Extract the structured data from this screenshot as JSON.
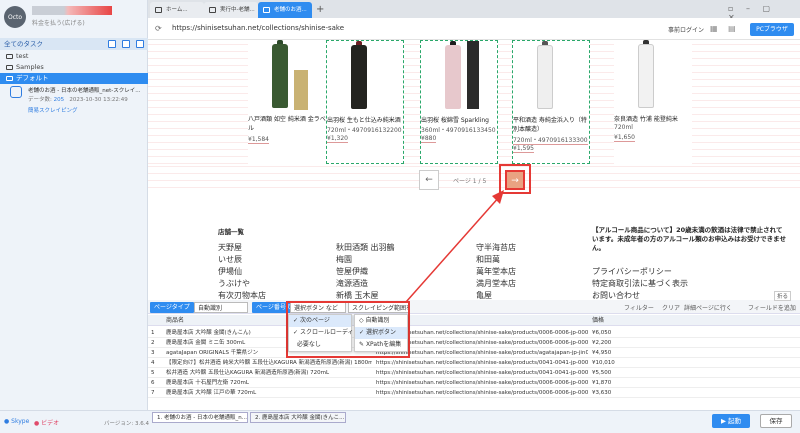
{
  "sidebar": {
    "logo_text": "Octo",
    "account_sub": "料金を払う(広げる)",
    "tasks_title": "全てのタスク",
    "tree": [
      {
        "label": "test"
      },
      {
        "label": "Samples"
      },
      {
        "label": "デフォルト"
      }
    ],
    "task": {
      "title": "老舗のお酒 - 日本の老舗通販_net-スクレイ...",
      "count_label": "データ数:",
      "count": "205",
      "date": "2023-10-30 13:22:49",
      "action": "簡易スクレイピング"
    },
    "skype": "Skype",
    "bilibili": "ビデオ",
    "version": "バージョン: 3.6.4"
  },
  "browser": {
    "tabs": [
      {
        "label": "ホーム..."
      },
      {
        "label": "実行中-老舗..."
      },
      {
        "label": "老舗のお酒..."
      }
    ],
    "new_tab": "+",
    "url": "https://shinisetsuhan.net/collections/shinise-sake",
    "login": "事前ログイン",
    "pc_browser": "PCブラウザ"
  },
  "products": [
    {
      "name": "八戸酒類 如空 純米酒 金ラベル",
      "price": "¥1,584",
      "sub": ""
    },
    {
      "name": "出羽桜 生もと仕込み純米酒",
      "sub": "720ml・4970916132200",
      "price": "¥1,320"
    },
    {
      "name": "出羽桜 桜綿雪 Sparkling",
      "sub": "360ml・4970916133450",
      "price": "¥880"
    },
    {
      "name": "平和酒造 寿純金浜入り（特別本醸造）",
      "sub": "720ml・4970916133300",
      "price": "¥1,595"
    },
    {
      "name": "奈良酒造 竹浦 能登純米",
      "sub": "720ml",
      "price": "¥1,650"
    }
  ],
  "pager": {
    "prev": "←",
    "text": "ページ 1 / 5",
    "next": "→"
  },
  "footer": {
    "heading": "店舗一覧",
    "col1": [
      "天野屋",
      "いせ辰",
      "伊場仙",
      "うぶけや",
      "有次刃物本店"
    ],
    "col2": [
      "秋田酒類 出羽鶴",
      "梅園",
      "笹屋伊織",
      "滝源酒造",
      "新橋 玉木屋"
    ],
    "col3": [
      "守半海苔店",
      "和田萬",
      "萬年堂本店",
      "満月堂本店",
      "亀屋"
    ],
    "notice": "【アルコール商品について】20歳未満の飲酒は法律で禁止されています。未成年者の方のアルコール類のお申込みはお受けできません。",
    "links": [
      "プライバシーポリシー",
      "特定商取引法に基づく表示",
      "お問い合わせ"
    ]
  },
  "panel": {
    "page_type_label": "ページタイプ",
    "page_type_value": "自動識別",
    "page_func_label": "ページ番号の確認",
    "select_value": "選択ボタン など",
    "scrape_range": "スクレイピング範囲を設定",
    "filter": "フィルター",
    "clear": "クリア",
    "detail": "詳細ページに行く",
    "add_field": "フィールドを追加",
    "collapse": "折る",
    "columns": [
      "商品名",
      "価格"
    ],
    "rows": [
      {
        "n": "1",
        "name": "鹿島屋本店 大吟醸 金閣(きんこん)",
        "url": "https://shinisetsuhan.net/collections/shinise-sake/products/0006-0006-jp-00006",
        "price": "¥6,050"
      },
      {
        "n": "2",
        "name": "鹿島屋本店 金閣 ミニ缶 300mL",
        "url": "https://shinisetsuhan.net/collections/shinise-sake/products/0006-0006-jp-00010",
        "price": "¥2,200"
      },
      {
        "n": "3",
        "name": "agataJapan ORIGINALS 千葉県ジン",
        "url": "https://shinisetsuhan.net/collections/shinise-sake/products/agatajapan-jp-jin012",
        "price": "¥4,950"
      },
      {
        "n": "4",
        "name": "【限定向け】松井酒造 純米大吟醸 五段仕込KAGURA 新潟酒造所原酒(新潟) 1800mL",
        "url": "https://shinisetsuhan.net/collections/shinise-sake/products/0041-0041-jp-00015",
        "price": "¥10,010"
      },
      {
        "n": "5",
        "name": "松井酒造 大吟醸 五段仕込KAGURA 新潟酒造所原酒(新潟) 720mL",
        "url": "https://shinisetsuhan.net/collections/shinise-sake/products/0041-0041-jp-00013",
        "price": "¥5,500"
      },
      {
        "n": "6",
        "name": "鹿島屋本店 十石屋門左衛 720mL",
        "url": "https://shinisetsuhan.net/collections/shinise-sake/products/0006-0006-jp-00001",
        "price": "¥1,870"
      },
      {
        "n": "7",
        "name": "鹿島屋本店 大吟醸 江戸の華 720mL",
        "url": "https://shinisetsuhan.net/collections/shinise-sake/products/0006-0006-jp-00007",
        "price": "¥3,630"
      }
    ]
  },
  "dropdown1": [
    "次のページ",
    "スクロールローディング",
    "必要なし"
  ],
  "dropdown2": [
    "自動識別",
    "選択ボタン",
    "XPathを編集"
  ],
  "bottom_tabs": [
    "1. 老舗のお酒 - 日本の老舗通販_n...",
    "2. 鹿島屋本店 大吟醸 金閣(きんこ..."
  ],
  "run": "▶ 起動",
  "save": "保存",
  "colors": {
    "accent": "#2f8cf0",
    "highlight": "#e53935"
  }
}
